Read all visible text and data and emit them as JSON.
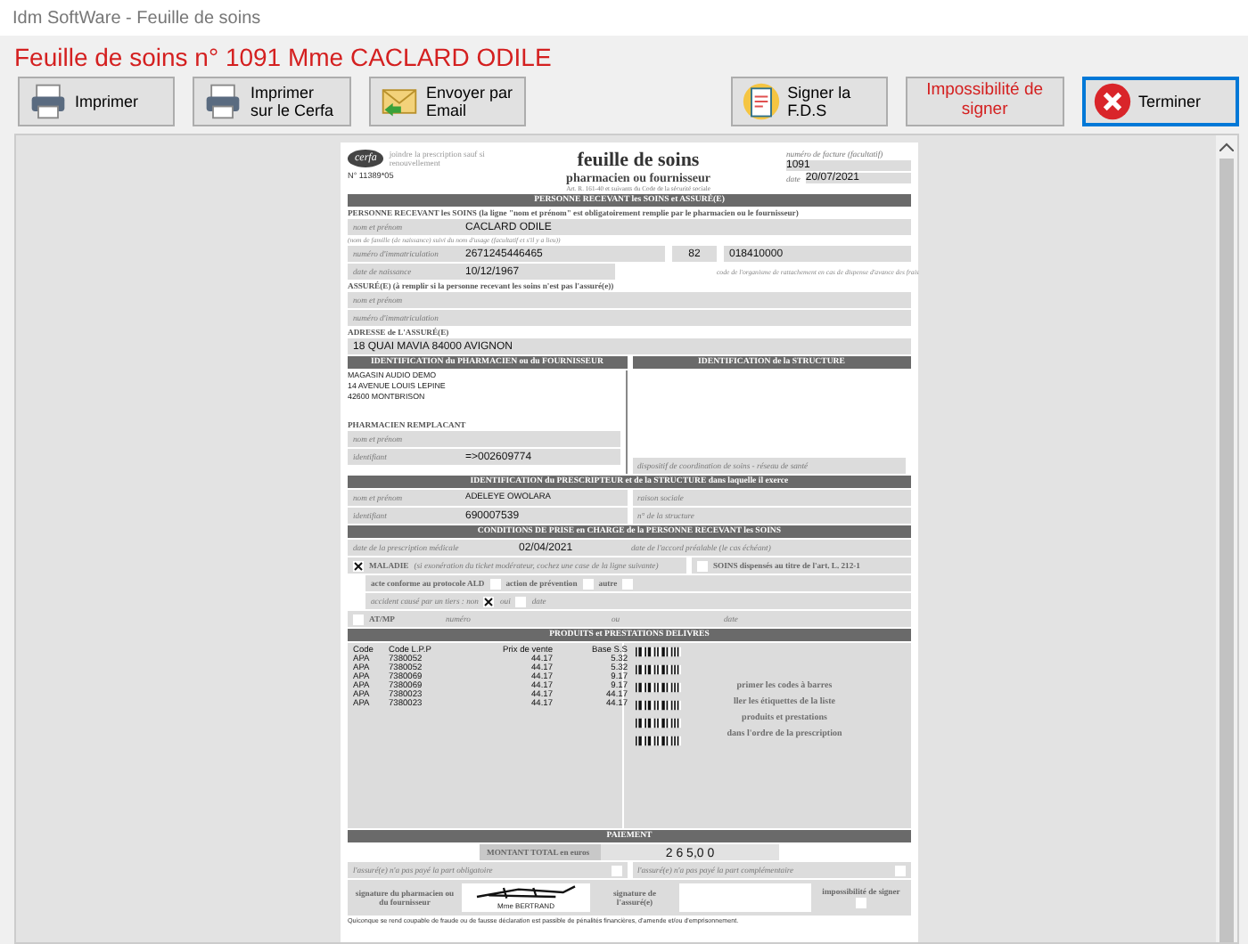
{
  "window": {
    "title": "Idm SoftWare - Feuille de soins"
  },
  "heading": "Feuille de soins n° 1091 Mme CACLARD ODILE",
  "toolbar": [
    {
      "label": "Imprimer",
      "kind": "printer",
      "focused": false
    },
    {
      "label": "Imprimer sur le Cerfa",
      "kind": "printer2",
      "focused": false
    },
    {
      "label": "Envoyer par Email",
      "kind": "email",
      "focused": false
    },
    {
      "label": "Signer la F.D.S",
      "kind": "sign",
      "focused": false
    },
    {
      "label": "Impossibilité de signer",
      "kind": "text",
      "focused": false
    },
    {
      "label": "Terminer",
      "kind": "close",
      "focused": true
    }
  ],
  "document": {
    "logo": "cerfa",
    "form_number": "N° 11389*05",
    "note": "joindre la prescription sauf si renouvellement",
    "title": "feuille de soins",
    "subtitle": "pharmacien ou fournisseur",
    "legal": "Art. R. 161-40 et suivants du Code de la sécurité sociale",
    "invoice_label": "numéro de facture (facultatif)",
    "invoice": "1091",
    "date_label": "date",
    "date": "20/07/2021",
    "patient": {
      "header": "PERSONNE RECEVANT les SOINS et ASSURÉ(E)",
      "intro": "PERSONNE RECEVANT les SOINS (la ligne \"nom et prénom\" est obligatoirement remplie par le pharmacien ou le fournisseur)",
      "name_label": "nom et prénom",
      "name": "CACLARD ODILE",
      "name_hint": "(nom de famille (de naissance) suivi du nom d'usage (facultatif et s'il y a lieu))",
      "immat_label": "numéro d'immatriculation",
      "immat": "2671245446465",
      "rank": "82",
      "org": "018410000",
      "org_note": "code de l'organisme de rattachement en cas de dispense d'avance des frais",
      "birth_label": "date de naissance",
      "birth": "10/12/1967",
      "insured": "ASSURÉ(E) (à remplir si la personne recevant les soins n'est pas l'assuré(e))",
      "insured_name_label": "nom et prénom",
      "insured_immat_label": "numéro d'immatriculation",
      "address_label": "ADRESSE de L'ASSURÉ(E)",
      "address": "18 QUAI MAVIA 84000 AVIGNON"
    },
    "pharmacist": {
      "header": "IDENTIFICATION du PHARMACIEN ou du FOURNISSEUR",
      "structure_header": "IDENTIFICATION de la STRUCTURE",
      "address": [
        "MAGASIN AUDIO DEMO",
        "14 AVENUE LOUIS LEPINE",
        "42600 MONTBRISON"
      ],
      "replacement": "PHARMACIEN REMPLACANT",
      "name_label": "nom et prénom",
      "id_label": "identifiant",
      "id": "=>002609774",
      "network": "dispositif de coordination de soins - réseau de santé"
    },
    "prescriber": {
      "header": "IDENTIFICATION du PRESCRIPTEUR et de la STRUCTURE dans laquelle il exerce",
      "name_label": "nom et prénom",
      "name": "ADELEYE OWOLARA",
      "id_label": "identifiant",
      "id": "690007539",
      "company_label": "raison sociale",
      "structure_label": "n° de la structure"
    },
    "conditions": {
      "header": "CONDITIONS DE PRISE en CHARGE de la PERSONNE RECEVANT les SOINS",
      "prescription_label": "date de la prescription médicale",
      "prescription_date": "02/04/2021",
      "agreement_label": "date de l'accord préalable (le cas échéant)",
      "illness": {
        "label": "MALADIE",
        "note": "(si exonération du ticket modérateur, cochez une case de la ligne suivante)",
        "checked": true
      },
      "article": {
        "label": "SOINS dispensés au titre de l'art. L. 212-1",
        "checked": false
      },
      "ald": {
        "label": "acte conforme au protocole ALD",
        "checked": false
      },
      "prevention": {
        "label": "action de prévention",
        "checked": false
      },
      "other": {
        "label": "autre",
        "checked": false
      },
      "accident_label": "accident causé par un tiers : non",
      "accident_no": true,
      "accident_yes_label": "oui",
      "accident_yes": false,
      "accident_date_label": "date",
      "atmp": {
        "label": "AT/MP",
        "checked": false
      },
      "number_label": "numéro",
      "or_label": "ou",
      "date_label": "date"
    },
    "products": {
      "header": "PRODUITS et PRESTATIONS DELIVRES",
      "columns": [
        "Code",
        "Code L.P.P",
        "Prix de vente",
        "Base S.S"
      ],
      "rows": [
        [
          "APA",
          "7380052",
          "44.17",
          "5.32"
        ],
        [
          "APA",
          "7380052",
          "44.17",
          "5.32"
        ],
        [
          "APA",
          "7380069",
          "44.17",
          "9.17"
        ],
        [
          "APA",
          "7380069",
          "44.17",
          "9.17"
        ],
        [
          "APA",
          "7380023",
          "44.17",
          "44.17"
        ],
        [
          "APA",
          "7380023",
          "44.17",
          "44.17"
        ]
      ],
      "instructions": [
        "primer les codes à barres",
        "ller les étiquettes de la liste",
        "produits et prestations",
        "dans l'ordre de la prescription"
      ]
    },
    "payment": {
      "header": "PAIEMENT",
      "total_label": "MONTANT TOTAL en euros",
      "total": "2 6 5,0 0",
      "unpaid_mandatory": {
        "label": "l'assuré(e) n'a pas payé la part obligatoire",
        "checked": false
      },
      "unpaid_complementary": {
        "label": "l'assuré(e) n'a pas payé la part complémentaire",
        "checked": false
      },
      "pharmacist_signature": "signature du pharmacien ou du fournisseur",
      "signer": "Mme BERTRAND",
      "insured_signature": "signature de l'assuré(e)",
      "cannot_sign": {
        "label": "impossibilité de signer",
        "checked": false
      },
      "footer": "Quiconque se rend coupable de fraude ou de fausse déclaration est passible de pénalités financières, d'amende et/ou d'emprisonnement."
    }
  }
}
